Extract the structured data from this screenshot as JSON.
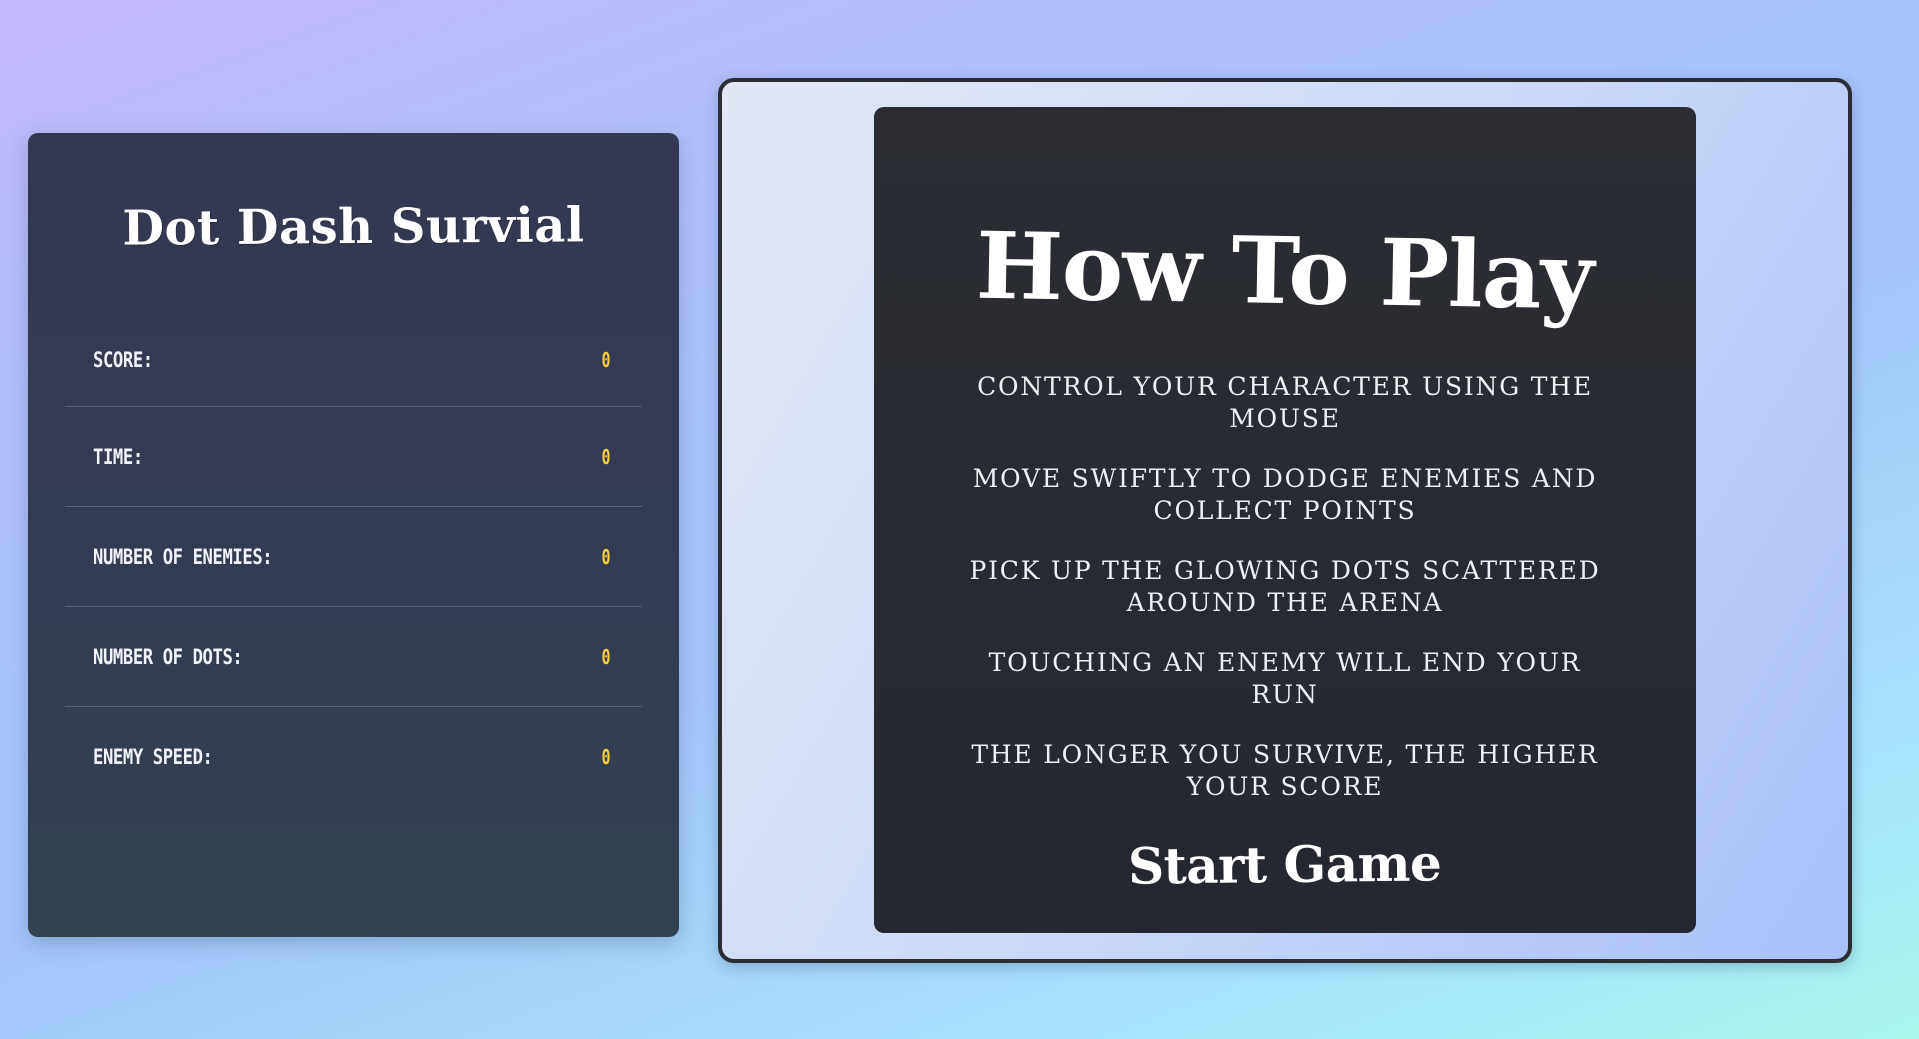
{
  "sidebar": {
    "title": "Dot Dash Survial",
    "stats": [
      {
        "label": "SCORE:",
        "value": "0"
      },
      {
        "label": "TIME:",
        "value": "0"
      },
      {
        "label": "NUMBER OF ENEMIES:",
        "value": "0"
      },
      {
        "label": "NUMBER OF DOTS:",
        "value": "0"
      },
      {
        "label": "ENEMY SPEED:",
        "value": "0"
      }
    ]
  },
  "howto": {
    "title": "How To Play",
    "instructions": [
      "CONTROL YOUR CHARACTER USING THE MOUSE",
      "MOVE SWIFTLY TO DODGE ENEMIES AND COLLECT POINTS",
      "PICK UP THE GLOWING DOTS SCATTERED AROUND THE ARENA",
      "TOUCHING AN ENEMY WILL END YOUR RUN",
      "THE LONGER YOU SURVIVE, THE HIGHER YOUR SCORE"
    ],
    "start_label": "Start Game"
  },
  "colors": {
    "panel_bg": "#343852",
    "card_bg": "#2b2d33",
    "stat_value": "#f5cf3b",
    "frame_border": "#2b2d33"
  }
}
